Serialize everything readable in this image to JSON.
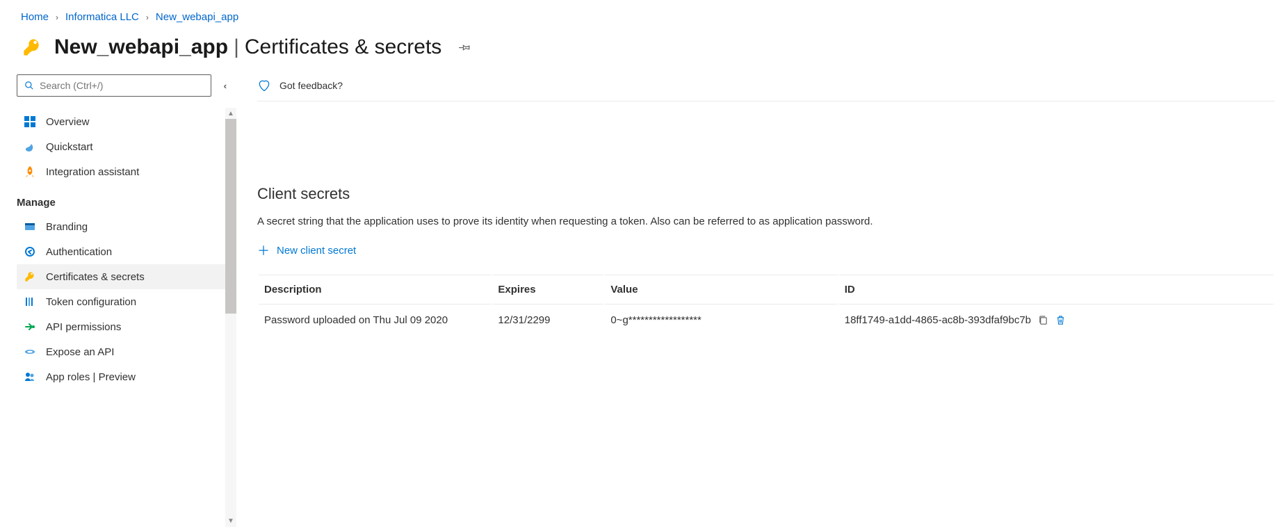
{
  "breadcrumb": {
    "home": "Home",
    "org": "Informatica LLC",
    "app": "New_webapi_app"
  },
  "title": {
    "app_name": "New_webapi_app",
    "separator": "|",
    "page_name": "Certificates & secrets"
  },
  "sidebar": {
    "search_placeholder": "Search (Ctrl+/)",
    "items_top": [
      {
        "label": "Overview"
      },
      {
        "label": "Quickstart"
      },
      {
        "label": "Integration assistant"
      }
    ],
    "section_manage": "Manage",
    "items_manage": [
      {
        "label": "Branding"
      },
      {
        "label": "Authentication"
      },
      {
        "label": "Certificates & secrets"
      },
      {
        "label": "Token configuration"
      },
      {
        "label": "API permissions"
      },
      {
        "label": "Expose an API"
      },
      {
        "label": "App roles | Preview"
      }
    ]
  },
  "content": {
    "feedback": "Got feedback?",
    "section_heading": "Client secrets",
    "section_desc": "A secret string that the application uses to prove its identity when requesting a token. Also can be referred to as application password.",
    "new_secret_btn": "New client secret",
    "table": {
      "headers": {
        "description": "Description",
        "expires": "Expires",
        "value": "Value",
        "id": "ID"
      },
      "rows": [
        {
          "description": "Password uploaded on Thu Jul 09 2020",
          "expires": "12/31/2299",
          "value": "0~g******************",
          "id": "18ff1749-a1dd-4865-ac8b-393dfaf9bc7b"
        }
      ]
    }
  }
}
